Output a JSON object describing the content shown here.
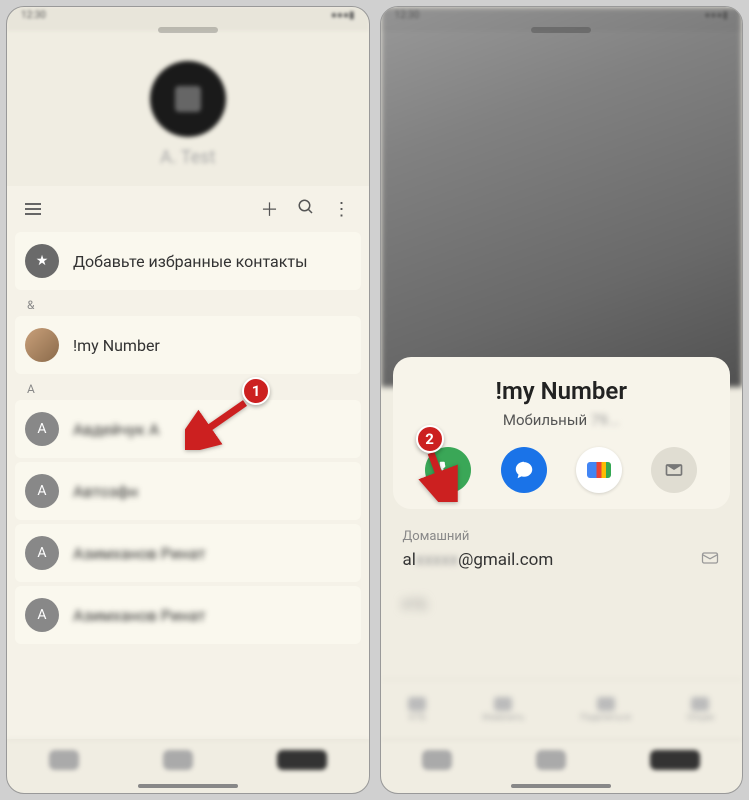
{
  "left": {
    "profile_name": "A. Test",
    "favorites_label": "Добавьте избранные контакты",
    "sections": {
      "amp": "&",
      "a": "A"
    },
    "contacts": {
      "my_number": "!my Number",
      "c1": "Авдейчук А",
      "c2": "Автозфн",
      "c3": "Азимханов Ринат",
      "c4": "Азимханов Ринат"
    }
  },
  "right": {
    "name": "!my Number",
    "phone_label": "Мобильный",
    "phone_number": "79...",
    "email_label": "Домашний",
    "email_value": "al...@gmail.com",
    "tabs": {
      "t1": "КТБ",
      "t2": "Изменить",
      "t3": "Поделиться",
      "t4": "Опции"
    }
  },
  "annotations": {
    "b1": "1",
    "b2": "2"
  }
}
